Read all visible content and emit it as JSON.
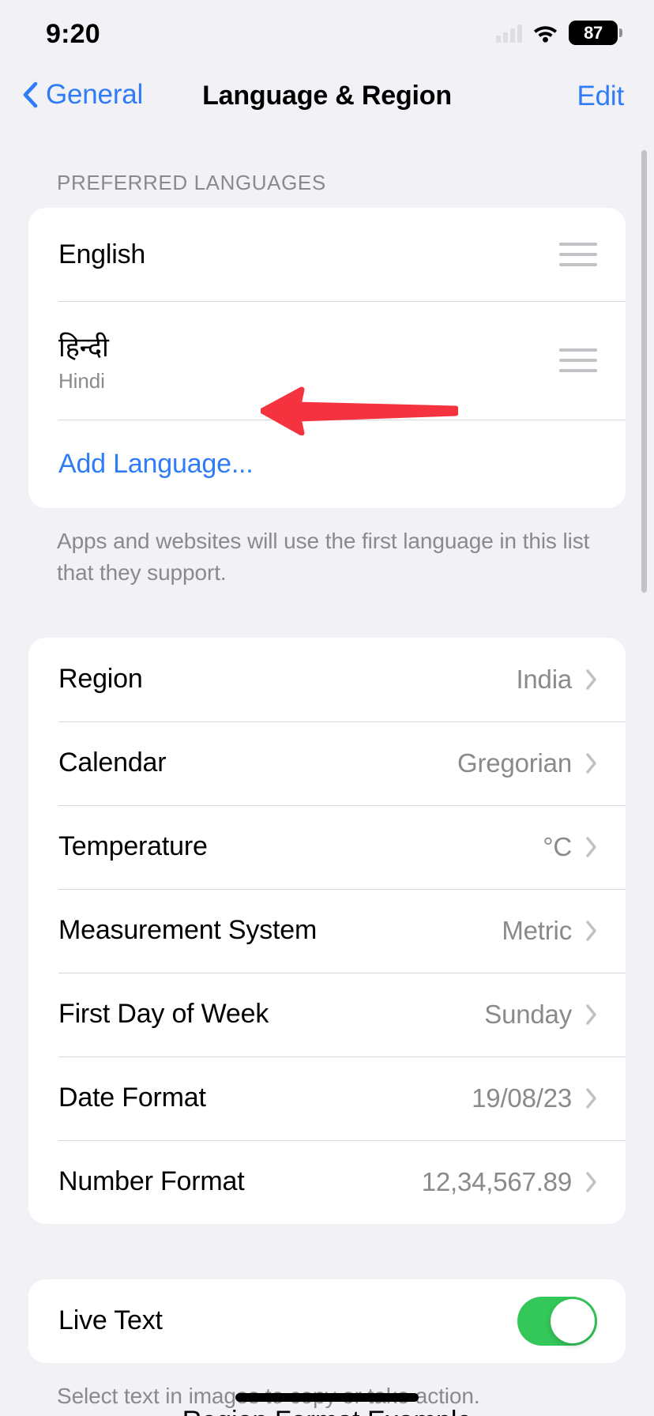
{
  "status_bar": {
    "time": "9:20",
    "battery_percent": "87",
    "wifi_icon": "wifi-icon",
    "cellular_icon": "cellular-bars-icon"
  },
  "nav_bar": {
    "back_label": "General",
    "back_icon": "chevron-left-icon",
    "title": "Language & Region",
    "edit_label": "Edit"
  },
  "preferred_languages": {
    "header": "PREFERRED LANGUAGES",
    "items": [
      {
        "name": "English",
        "subtitle": "",
        "handle_icon": "drag-handle-icon"
      },
      {
        "name": "हिन्दी",
        "subtitle": "Hindi",
        "handle_icon": "drag-handle-icon"
      }
    ],
    "add_language_label": "Add Language...",
    "footer": "Apps and websites will use the first language in this list that they support."
  },
  "region_settings": {
    "rows": [
      {
        "label": "Region",
        "value": "India",
        "chevron": "chevron-right-icon"
      },
      {
        "label": "Calendar",
        "value": "Gregorian",
        "chevron": "chevron-right-icon"
      },
      {
        "label": "Temperature",
        "value": "°C",
        "chevron": "chevron-right-icon"
      },
      {
        "label": "Measurement System",
        "value": "Metric",
        "chevron": "chevron-right-icon"
      },
      {
        "label": "First Day of Week",
        "value": "Sunday",
        "chevron": "chevron-right-icon"
      },
      {
        "label": "Date Format",
        "value": "19/08/23",
        "chevron": "chevron-right-icon"
      },
      {
        "label": "Number Format",
        "value": "12,34,567.89",
        "chevron": "chevron-right-icon"
      }
    ]
  },
  "live_text": {
    "label": "Live Text",
    "toggle_state": "on",
    "footer": "Select text in images to copy or take action."
  },
  "next_section": {
    "header": "Region Format Example"
  },
  "annotation": {
    "arrow_icon": "arrow-left-annotation",
    "color": "#F5333F",
    "points_to": "Add Language..."
  },
  "colors": {
    "accent_blue": "#2F7CF6",
    "toggle_green": "#34C759",
    "background": "#F2F1F6",
    "card": "#FFFFFF",
    "secondary_text": "#8A8A8E",
    "annotation_red": "#F5333F"
  }
}
